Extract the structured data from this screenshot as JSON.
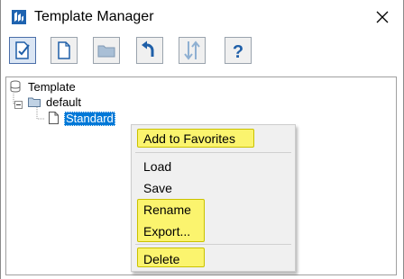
{
  "window": {
    "title": "Template Manager",
    "icon": "template-manager-app-icon",
    "close_icon": "close-icon"
  },
  "toolbar": {
    "buttons": [
      {
        "name": "select-template",
        "icon": "document-check-icon",
        "active": true
      },
      {
        "name": "new-template",
        "icon": "new-document-icon",
        "active": false
      },
      {
        "name": "new-folder",
        "icon": "folder-icon",
        "active": false,
        "disabled": true
      },
      {
        "name": "undo",
        "icon": "undo-arrow-icon",
        "active": false
      },
      {
        "name": "sort",
        "icon": "sort-arrows-icon",
        "active": false,
        "disabled": true
      },
      {
        "name": "help",
        "icon": "help-icon",
        "active": false
      }
    ]
  },
  "tree": {
    "root_label": "Template",
    "folder_label": "default",
    "selected_label": "Standard"
  },
  "context_menu": {
    "items": [
      "Add to Favorites",
      "Load",
      "Save",
      "Rename",
      "Export...",
      "Delete"
    ],
    "highlighted": [
      "Add to Favorites",
      "Rename",
      "Export...",
      "Delete"
    ]
  },
  "colors": {
    "selection": "#0078d7",
    "highlight": "#fff53c",
    "toolbar_icon_blue": "#1f5fa8"
  }
}
